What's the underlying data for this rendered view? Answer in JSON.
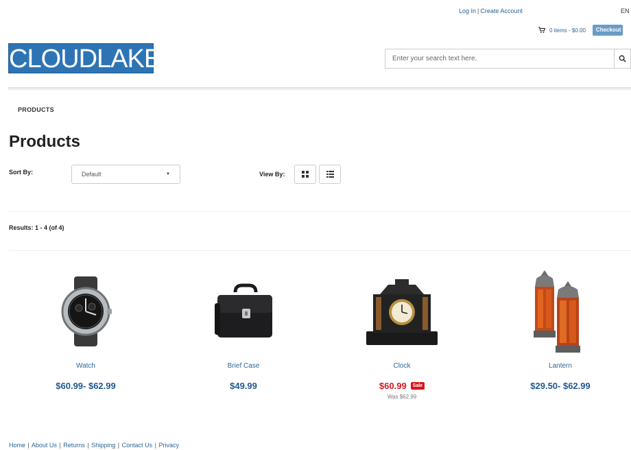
{
  "header": {
    "login_label": "Log In",
    "create_account_label": "Create Account",
    "separator": "|",
    "language": "EN",
    "cart_summary": "0 items - $0.00",
    "checkout_label": "Checkout",
    "logo_text": "CLOUDLAKE",
    "search_placeholder": "Enter your search text here."
  },
  "breadcrumb": {
    "label": "PRODUCTS"
  },
  "page": {
    "title": "Products"
  },
  "controls": {
    "sort_label": "Sort By:",
    "sort_value": "Default",
    "view_label": "View By:"
  },
  "results": {
    "text": "Results: 1 - 4 (of 4)"
  },
  "products": [
    {
      "name": "Watch",
      "price": "$60.99- $62.99"
    },
    {
      "name": "Brief Case",
      "price": "$49.99"
    },
    {
      "name": "Clock",
      "price": "$60.99",
      "badge": "Sale",
      "was": "Was  $62.99"
    },
    {
      "name": "Lantern",
      "price": "$29.50- $62.99"
    }
  ],
  "footer": {
    "links": [
      "Home",
      "About Us",
      "Returns",
      "Shipping",
      "Contact Us",
      "Privacy"
    ],
    "separator": "|"
  },
  "colors": {
    "brand": "#2d74b5",
    "link": "#2a6496",
    "sale": "#d9141c",
    "checkout": "#6a9cc6"
  }
}
